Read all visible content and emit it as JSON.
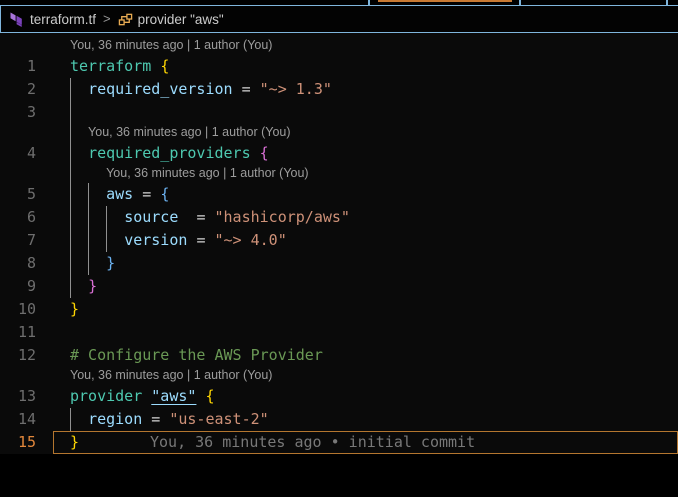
{
  "breadcrumb": {
    "file_label": "terraform.tf",
    "separator": ">",
    "symbol_label": "provider \"aws\""
  },
  "editor": {
    "codelens_text": "You, 36 minutes ago | 1 author (You)",
    "blame_text": "You, 36 minutes ago • initial commit",
    "rows": [
      {
        "type": "lens",
        "indent": 0
      },
      {
        "type": "code",
        "num": "1",
        "guides": [],
        "tokens": [
          [
            "kw",
            "terraform"
          ],
          [
            "pl",
            " "
          ],
          [
            "b1",
            "{"
          ]
        ]
      },
      {
        "type": "code",
        "num": "2",
        "guides": [
          0
        ],
        "tokens": [
          [
            "pl",
            "  "
          ],
          [
            "prop",
            "required_version"
          ],
          [
            "pl",
            " "
          ],
          [
            "op",
            "="
          ],
          [
            "pl",
            " "
          ],
          [
            "str",
            "\"~> 1.3\""
          ]
        ]
      },
      {
        "type": "code",
        "num": "3",
        "guides": [
          0
        ],
        "tokens": []
      },
      {
        "type": "lens",
        "indent": 1,
        "guides": [
          0
        ]
      },
      {
        "type": "code",
        "num": "4",
        "guides": [
          0
        ],
        "tokens": [
          [
            "pl",
            "  "
          ],
          [
            "kw",
            "required_providers"
          ],
          [
            "pl",
            " "
          ],
          [
            "b2",
            "{"
          ]
        ]
      },
      {
        "type": "lens",
        "indent": 2,
        "guides": [
          0
        ]
      },
      {
        "type": "code",
        "num": "5",
        "guides": [
          0,
          1
        ],
        "tokens": [
          [
            "pl",
            "    "
          ],
          [
            "prop",
            "aws"
          ],
          [
            "pl",
            " "
          ],
          [
            "op",
            "="
          ],
          [
            "pl",
            " "
          ],
          [
            "b3",
            "{"
          ]
        ]
      },
      {
        "type": "code",
        "num": "6",
        "guides": [
          0,
          1,
          2
        ],
        "tokens": [
          [
            "pl",
            "      "
          ],
          [
            "prop",
            "source"
          ],
          [
            "pl",
            "  "
          ],
          [
            "op",
            "="
          ],
          [
            "pl",
            " "
          ],
          [
            "str",
            "\"hashicorp/aws\""
          ]
        ]
      },
      {
        "type": "code",
        "num": "7",
        "guides": [
          0,
          1,
          2
        ],
        "tokens": [
          [
            "pl",
            "      "
          ],
          [
            "prop",
            "version"
          ],
          [
            "pl",
            " "
          ],
          [
            "op",
            "="
          ],
          [
            "pl",
            " "
          ],
          [
            "str",
            "\"~> 4.0\""
          ]
        ]
      },
      {
        "type": "code",
        "num": "8",
        "guides": [
          0,
          1
        ],
        "tokens": [
          [
            "pl",
            "    "
          ],
          [
            "b3",
            "}"
          ]
        ]
      },
      {
        "type": "code",
        "num": "9",
        "guides": [
          0
        ],
        "tokens": [
          [
            "pl",
            "  "
          ],
          [
            "b2",
            "}"
          ]
        ]
      },
      {
        "type": "code",
        "num": "10",
        "guides": [],
        "tokens": [
          [
            "b1",
            "}"
          ]
        ]
      },
      {
        "type": "code",
        "num": "11",
        "guides": [],
        "tokens": []
      },
      {
        "type": "code",
        "num": "12",
        "guides": [],
        "tokens": [
          [
            "cm",
            "# Configure the AWS Provider"
          ]
        ]
      },
      {
        "type": "lens",
        "indent": 0
      },
      {
        "type": "code",
        "num": "13",
        "guides": [],
        "tokens": [
          [
            "kw",
            "provider"
          ],
          [
            "pl",
            " "
          ],
          [
            "strl",
            "\"aws\""
          ],
          [
            "pl",
            " "
          ],
          [
            "b1",
            "{"
          ]
        ]
      },
      {
        "type": "code",
        "num": "14",
        "guides": [
          0
        ],
        "tokens": [
          [
            "pl",
            "  "
          ],
          [
            "prop",
            "region"
          ],
          [
            "pl",
            " "
          ],
          [
            "op",
            "="
          ],
          [
            "pl",
            " "
          ],
          [
            "str",
            "\"us-east-2\""
          ]
        ]
      },
      {
        "type": "code",
        "num": "15",
        "guides": [],
        "current": true,
        "blame": true,
        "tokens": [
          [
            "b1",
            "}"
          ]
        ]
      }
    ]
  },
  "colors": {
    "keyword": "#4EC9B0",
    "property": "#9CDCFE",
    "operator": "#D4D4D4",
    "string": "#CE9178",
    "comment": "#6A9955",
    "bracket1": "#FFD602",
    "bracket2": "#DA70D6",
    "bracket3": "#6CB3F2",
    "line_number": "#6e6e6e",
    "active_line_number": "#E2873B",
    "current_line_border": "#B4762F",
    "codelens": "#9d9d9d",
    "blame": "#787878",
    "indent_guide": "#909090",
    "breadcrumb_text": "#CCCCCC",
    "focus_border": "#7FB5DC",
    "accent_orange": "#C77A34",
    "terraform_purple": "#7B42BC",
    "terraform_purple_light": "#A874DB",
    "symbol_icon": "#E8AB53"
  }
}
